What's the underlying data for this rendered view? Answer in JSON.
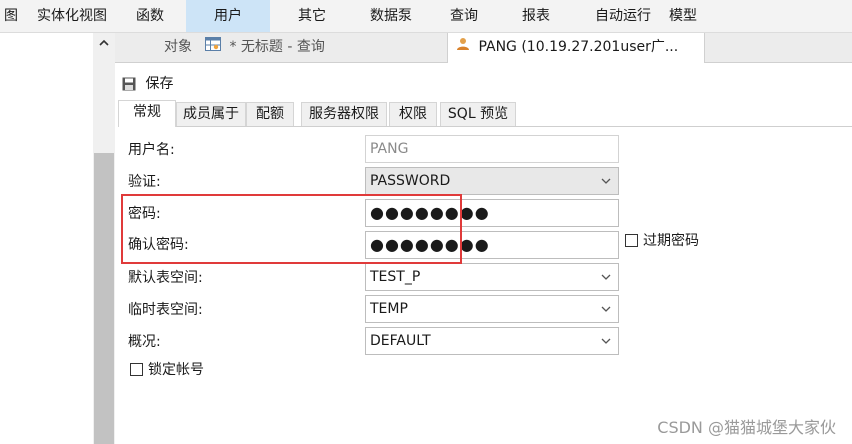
{
  "menubar": {
    "items": [
      {
        "label": "图"
      },
      {
        "label": "实体化视图"
      },
      {
        "label": "函数"
      },
      {
        "label": "用户"
      },
      {
        "label": "其它"
      },
      {
        "label": "数据泵"
      },
      {
        "label": "查询"
      },
      {
        "label": "报表"
      },
      {
        "label": "自动运行"
      },
      {
        "label": "模型"
      }
    ],
    "active": "用户"
  },
  "tabs": [
    {
      "label": "对象"
    },
    {
      "label": "* 无标题 - 查询"
    },
    {
      "label": "PANG (10.19.27.201user广..."
    }
  ],
  "toolbar": {
    "save_label": "保存"
  },
  "property_tabs": [
    "常规",
    "成员属于",
    "配额",
    "服务器权限",
    "权限",
    "SQL 预览"
  ],
  "form": {
    "username_label": "用户名:",
    "username_value": "PANG",
    "auth_label": "验证:",
    "auth_value": "PASSWORD",
    "password_label": "密码:",
    "password_value": "●●●●●●●●",
    "confirm_label": "确认密码:",
    "confirm_value": "●●●●●●●●",
    "expired_label": "过期密码",
    "default_ts_label": "默认表空间:",
    "default_ts_value": "TEST_P",
    "temp_ts_label": "临时表空间:",
    "temp_ts_value": "TEMP",
    "profile_label": "概况:",
    "profile_value": "DEFAULT",
    "lock_label": "锁定帐号"
  },
  "watermark": "CSDN @猫猫城堡大家伙",
  "colors": {
    "highlight": "#e03a3a",
    "active_menu": "#cde4f7"
  }
}
